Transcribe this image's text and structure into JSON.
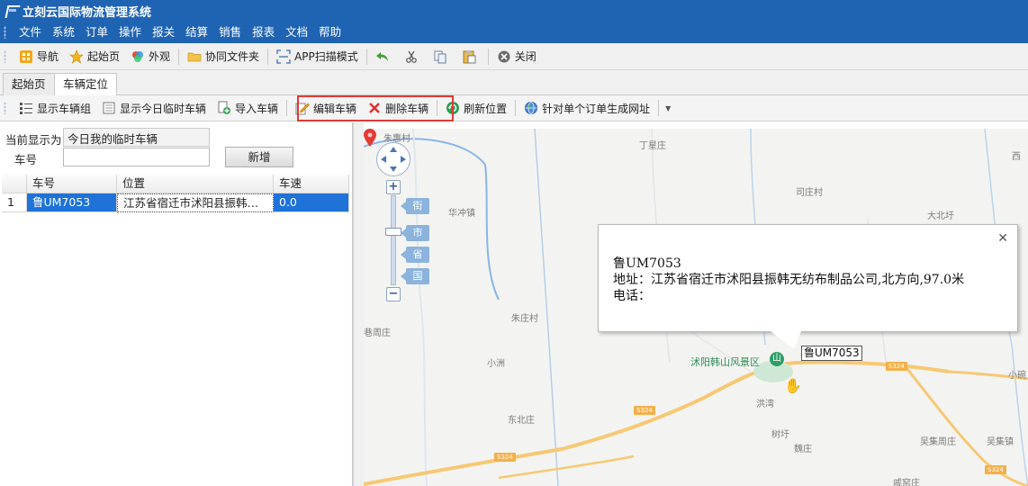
{
  "app": {
    "title": "立刻云国际物流管理系统"
  },
  "menubar": {
    "items": [
      "文件",
      "系统",
      "订单",
      "操作",
      "报关",
      "结算",
      "销售",
      "报表",
      "文档",
      "帮助"
    ]
  },
  "toolbar": {
    "nav": "导航",
    "home": "起始页",
    "appearance": "外观",
    "shared_folder": "协同文件夹",
    "app_scan": "APP扫描模式",
    "close": "关闭"
  },
  "tabs": [
    "起始页",
    "车辆定位"
  ],
  "subtoolbar": {
    "show_groups": "显示车辆组",
    "show_today_temp": "显示今日临时车辆",
    "import": "导入车辆",
    "edit": "编辑车辆",
    "delete": "删除车辆",
    "refresh": "刷新位置",
    "gen_url": "针对单个订单生成网址"
  },
  "filter": {
    "current_label": "当前显示为",
    "current_value": "今日我的临时车辆",
    "plate_label": "车号",
    "plate_value": "",
    "add_button": "新增"
  },
  "grid": {
    "headers": [
      "车号",
      "位置",
      "车速"
    ],
    "rows": [
      {
        "rn": "1",
        "plate": "鲁UM7053",
        "location": "江苏省宿迁市沭阳县振韩无纺布制品公司,北方向,97.0米",
        "speed": "0.0"
      }
    ]
  },
  "map": {
    "labels": {
      "zhuhui": "朱惠村",
      "dingxing": "丁星庄",
      "xi": "西",
      "huachong": "华冲镇",
      "sizhuang": "司庄村",
      "dabei": "大北圩",
      "zhu": "朱庄村",
      "zhou": "巷周庄",
      "xiaoxiao": "小洲",
      "dongbei": "东北庄",
      "shuyang": "沭阳韩山风景区",
      "hongwan": "洪湾",
      "shuyu": "树圩",
      "weizhuang": "魏庄",
      "wuji": "吴集周庄",
      "wujizhen": "吴集镇",
      "xiaowan": "小碗",
      "weiyao": "戚窑庄"
    },
    "road_shields": [
      "S324",
      "S324",
      "S324",
      "S324"
    ],
    "level_tags": [
      "街",
      "市",
      "省",
      "国"
    ],
    "zoom_in": "+",
    "zoom_out": "−",
    "marker_label": "鲁UM7053",
    "scenic_icon": "山",
    "popup": {
      "plate": "鲁UM7053",
      "address": "地址：江苏省宿迁市沭阳县振韩无纺布制品公司,北方向,97.0米",
      "phone": "电话：",
      "close": "✕"
    }
  },
  "colors": {
    "title_bg": "#1f63b3",
    "selection": "#1e72d8",
    "highlight_box": "#e03a36",
    "marker": "#e53935",
    "road": "#f7c873"
  }
}
